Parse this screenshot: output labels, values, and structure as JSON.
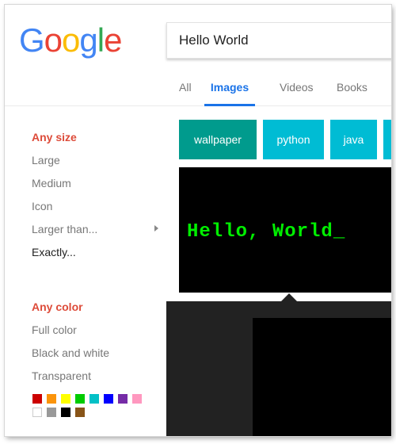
{
  "logo": {
    "letters": [
      "G",
      "o",
      "o",
      "g",
      "l",
      "e"
    ]
  },
  "search": {
    "value": "Hello World"
  },
  "tabs": [
    "All",
    "Images",
    "Videos",
    "Books"
  ],
  "active_tab": "Images",
  "filters": {
    "size_heading": "Any size",
    "size_options": [
      "Large",
      "Medium",
      "Icon",
      "Larger than...",
      "Exactly..."
    ],
    "color_heading": "Any color",
    "color_options": [
      "Full color",
      "Black and white",
      "Transparent"
    ],
    "color_swatches": [
      "#cc0000",
      "#fb940b",
      "#ffff00",
      "#00cc00",
      "#03c0c6",
      "#0000ff",
      "#762ca7",
      "#ff98bf",
      "#ffffff",
      "#999999",
      "#000000",
      "#885418"
    ]
  },
  "suggestion_chips": [
    "wallpaper",
    "python",
    "java"
  ],
  "results": {
    "image_1_text": "Hello, World_"
  },
  "colors": {
    "logo": [
      "#4285f4",
      "#ea4335",
      "#fbbc05",
      "#4285f4",
      "#34a853",
      "#ea4335"
    ],
    "chip_1": "#009b8d",
    "chip": "#00bcd4",
    "accent": "#1a73e8",
    "heading": "#dd4b39",
    "terminal_text": "#00ee00"
  }
}
